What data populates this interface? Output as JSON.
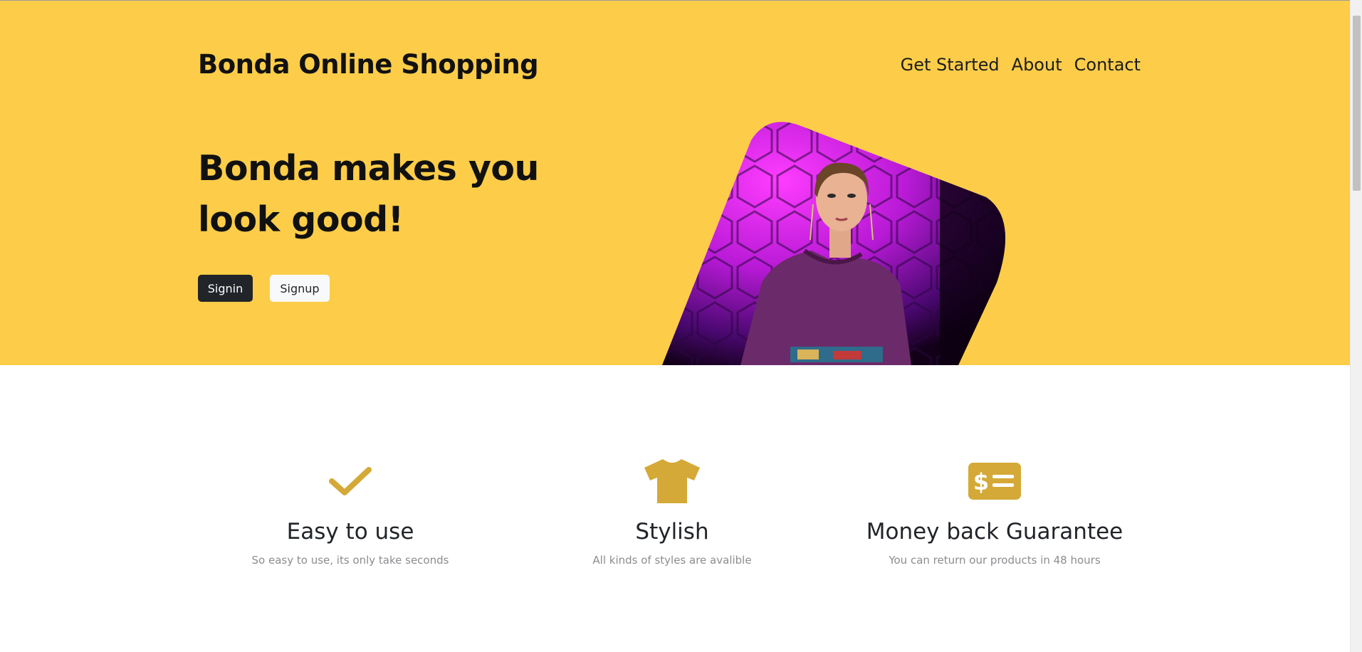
{
  "header": {
    "brand": "Bonda Online Shopping",
    "nav": [
      "Get Started",
      "About",
      "Contact"
    ]
  },
  "hero": {
    "headline": "Bonda makes you look good!",
    "signin_label": "Signin",
    "signup_label": "Signup",
    "background_color": "#fdcd49"
  },
  "features": [
    {
      "icon": "check-icon",
      "title": "Easy to use",
      "description": "So easy to use, its only take seconds"
    },
    {
      "icon": "tshirt-icon",
      "title": "Stylish",
      "description": "All kinds of styles are avalible"
    },
    {
      "icon": "money-check-icon",
      "title": "Money back Guarantee",
      "description": "You can return our products in 48 hours"
    }
  ],
  "colors": {
    "accent": "#d4a937",
    "dark_button": "#212529",
    "light_button": "#f8f9fa"
  }
}
